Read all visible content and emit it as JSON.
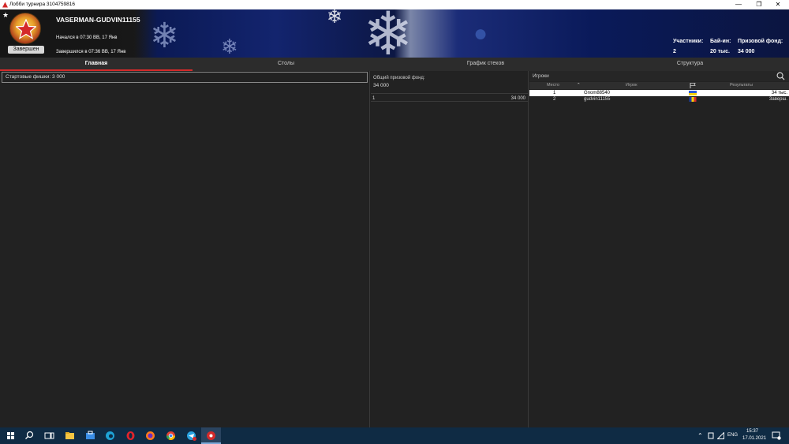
{
  "window": {
    "title": "Лобби турнира 3104759816",
    "minimize": "—",
    "maximize": "❐",
    "close": "✕"
  },
  "header": {
    "tournament_name": "VASERMAN-GUDVIN11155",
    "started": "Начался в 07:30 ВВ, 17 Янв",
    "ended": "Завершился в 07:36 ВВ, 17 Янв",
    "status": "Завершен",
    "stats": [
      {
        "label": "Участники:",
        "value": "2"
      },
      {
        "label": "Бай-ин:",
        "value": "20 тыс."
      },
      {
        "label": "Призовой фонд:",
        "value": "34 000"
      }
    ]
  },
  "tabs": [
    {
      "label": "Главная",
      "active": true
    },
    {
      "label": "Столы",
      "active": false
    },
    {
      "label": "График стеков",
      "active": false
    },
    {
      "label": "Структура",
      "active": false
    }
  ],
  "main": {
    "starting_chips_label": "Стартовые фишки:",
    "starting_chips_value": "3 000"
  },
  "prize_pool": {
    "label": "Общий призовой фонд:",
    "value": "34 000",
    "rows": [
      {
        "place": "1",
        "amount": "34 000"
      }
    ]
  },
  "players": {
    "title": "Игроки",
    "columns": {
      "place": "Место",
      "player": "Игрок",
      "results": "Результаты"
    },
    "rows": [
      {
        "place": "1",
        "name": "Gnom88540",
        "flag": "ukraine",
        "result": "34 тыс."
      },
      {
        "place": "2",
        "name": "gudvin11155",
        "flag": "romania",
        "result": "Заверш."
      }
    ]
  },
  "taskbar": {
    "lang": "ENG",
    "time": "15:37",
    "date": "17.01.2021"
  },
  "colors": {
    "accent": "#d42a2a",
    "taskbar": "#0f2b44",
    "header": "#13246e"
  }
}
